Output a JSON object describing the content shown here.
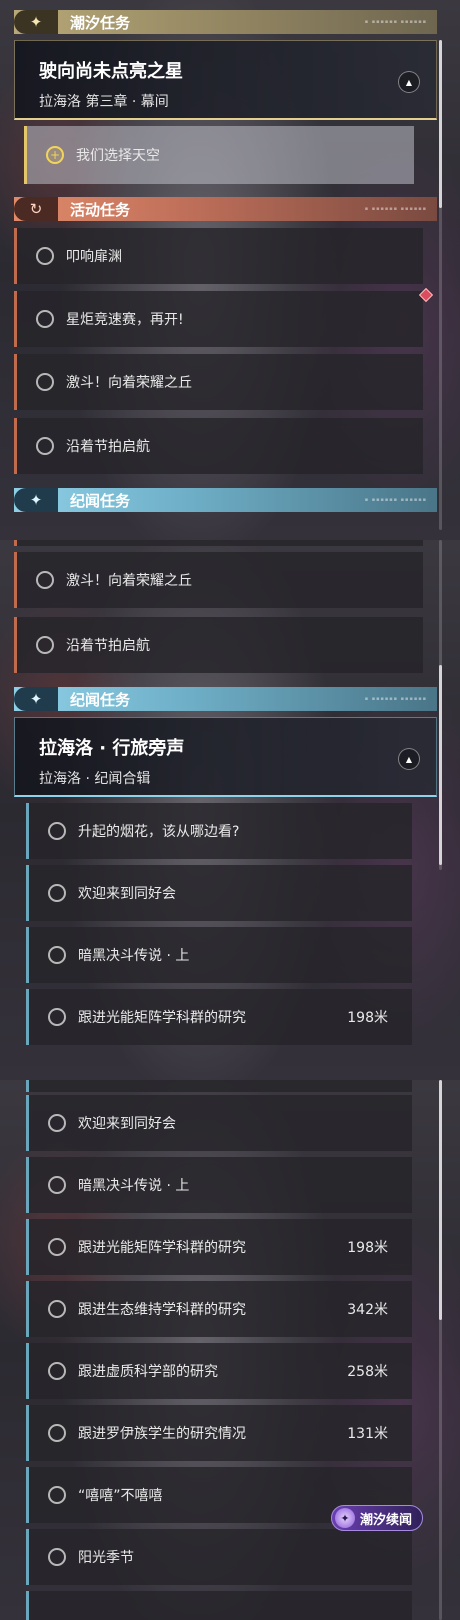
{
  "sections": {
    "tidal": {
      "label": "潮汐任务",
      "icon": "sparkle-icon"
    },
    "activity": {
      "label": "活动任务",
      "icon": "refresh-icon"
    },
    "journal": {
      "label": "纪闻任务",
      "icon": "sparkle-icon"
    },
    "deco_text": "▪ ▪▪▪▪▪▪ ▪▪▪▪▪▪"
  },
  "tidal_card": {
    "title": "驶向尚未点亮之星",
    "subtitle": "拉海洛 第三章 · 幕间",
    "collapse_icon": "chevron-up-icon"
  },
  "tidal_sub": {
    "label": "我们选择天空"
  },
  "activity_quests": [
    "叩响扉渊",
    "星炬竞速赛，再开!",
    "激斗！向着荣耀之丘",
    "沿着节拍启航"
  ],
  "journal_card": {
    "title": "拉海洛 · 行旅旁声",
    "subtitle": "拉海洛 · 纪闻合辑",
    "collapse_icon": "chevron-up-icon"
  },
  "journal_quests": [
    {
      "label": "升起的烟花，该从哪边看?",
      "dist": ""
    },
    {
      "label": "欢迎来到同好会",
      "dist": ""
    },
    {
      "label": "暗黑决斗传说 · 上",
      "dist": ""
    },
    {
      "label": "跟进光能矩阵学科群的研究",
      "dist": "198米"
    },
    {
      "label": "跟进生态维持学科群的研究",
      "dist": "342米"
    },
    {
      "label": "跟进虚质科学部的研究",
      "dist": "258米"
    },
    {
      "label": "跟进罗伊族学生的研究情况",
      "dist": "131米"
    },
    {
      "label": "“嘻嘻”不嘻嘻",
      "dist": ""
    },
    {
      "label": "阳光季节",
      "dist": ""
    }
  ],
  "logo": {
    "text": "潮汐续闻"
  },
  "colors": {
    "tidal": "#b8a878",
    "activity": "#e08a6a",
    "journal": "#8ecfe6",
    "active_circle": "#f2d45a"
  }
}
